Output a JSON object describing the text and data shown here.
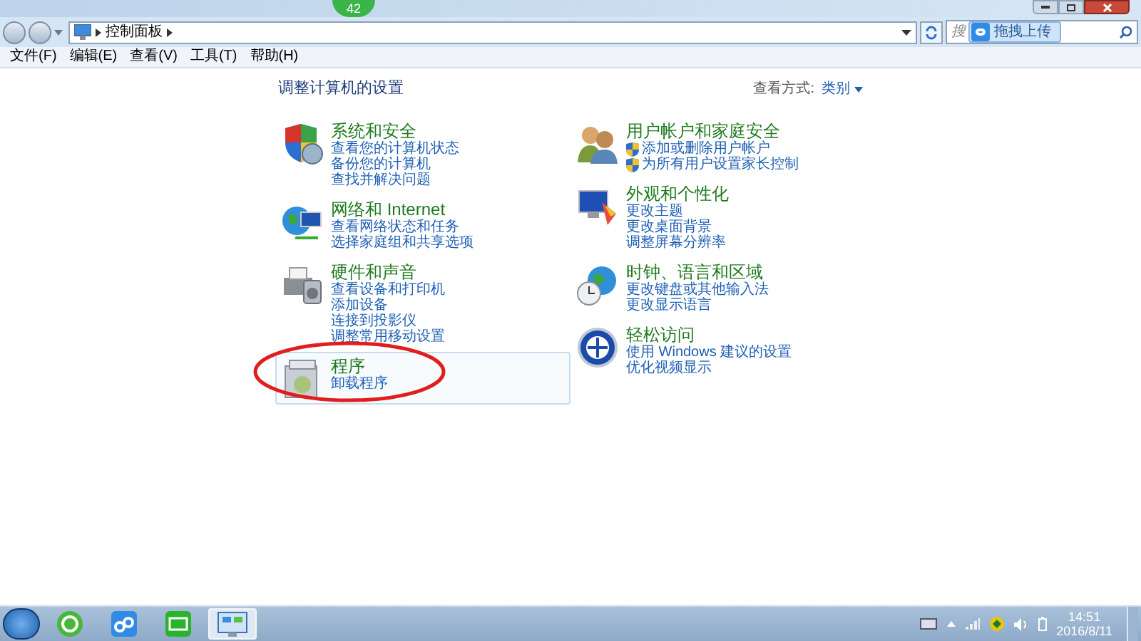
{
  "badge": "42",
  "address_bar": {
    "breadcrumb": "控制面板",
    "search": {
      "placeholder": "搜"
    }
  },
  "upload_button": "拖拽上传",
  "menu": [
    "文件(F)",
    "编辑(E)",
    "查看(V)",
    "工具(T)",
    "帮助(H)"
  ],
  "content": {
    "heading": "调整计算机的设置",
    "view_by": {
      "label": "查看方式:",
      "value": "类别"
    },
    "columns": [
      [
        {
          "title": "系统和安全",
          "selected": false,
          "links": [
            {
              "text": "查看您的计算机状态",
              "kind": "plain"
            },
            {
              "text": "备份您的计算机",
              "kind": "plain"
            },
            {
              "text": "查找并解决问题",
              "kind": "plain"
            }
          ]
        },
        {
          "title": "网络和 Internet",
          "selected": false,
          "links": [
            {
              "text": "查看网络状态和任务",
              "kind": "plain"
            },
            {
              "text": "选择家庭组和共享选项",
              "kind": "plain"
            }
          ]
        },
        {
          "title": "硬件和声音",
          "selected": false,
          "links": [
            {
              "text": "查看设备和打印机",
              "kind": "plain"
            },
            {
              "text": "添加设备",
              "kind": "plain"
            },
            {
              "text": "连接到投影仪",
              "kind": "plain"
            },
            {
              "text": "调整常用移动设置",
              "kind": "plain"
            }
          ]
        },
        {
          "title": "程序",
          "selected": true,
          "links": [
            {
              "text": "卸载程序",
              "kind": "plain"
            }
          ]
        }
      ],
      [
        {
          "title": "用户帐户和家庭安全",
          "selected": false,
          "links": [
            {
              "text": "添加或删除用户帐户",
              "kind": "shield"
            },
            {
              "text": "为所有用户设置家长控制",
              "kind": "shield"
            }
          ]
        },
        {
          "title": "外观和个性化",
          "selected": false,
          "links": [
            {
              "text": "更改主题",
              "kind": "plain"
            },
            {
              "text": "更改桌面背景",
              "kind": "plain"
            },
            {
              "text": "调整屏幕分辨率",
              "kind": "plain"
            }
          ]
        },
        {
          "title": "时钟、语言和区域",
          "selected": false,
          "links": [
            {
              "text": "更改键盘或其他输入法",
              "kind": "plain"
            },
            {
              "text": "更改显示语言",
              "kind": "plain"
            }
          ]
        },
        {
          "title": "轻松访问",
          "selected": false,
          "links": [
            {
              "text": "使用 Windows 建议的设置",
              "kind": "plain"
            },
            {
              "text": "优化视频显示",
              "kind": "plain"
            }
          ]
        }
      ]
    ]
  },
  "taskbar": {
    "items": [
      {
        "selected": false
      },
      {
        "selected": false
      },
      {
        "selected": false
      },
      {
        "selected": true
      }
    ],
    "clock": {
      "time": "14:51",
      "date": "2016/8/11"
    }
  }
}
